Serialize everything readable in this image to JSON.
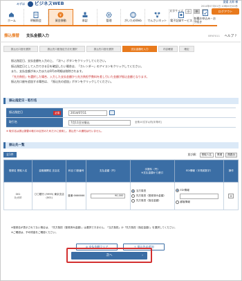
{
  "brand": {
    "sub": "みずほ",
    "name": "ビジネスWEB"
  },
  "user": {
    "name": "愛媛 太郎 様",
    "last_login": "2014年07月01日 10時00分00秒"
  },
  "util": {
    "size_label": "文字サイズ",
    "sizes": [
      "小",
      "中",
      "大"
    ],
    "logout": "ログアウト"
  },
  "nav": [
    {
      "label": "ホーム",
      "icon": "home-icon"
    },
    {
      "label": "明細照会",
      "icon": "document-icon"
    },
    {
      "label": "資金移動",
      "icon": "yen-icon",
      "active": true
    },
    {
      "label": "承認",
      "icon": "stamp-icon"
    },
    {
      "label": "管理",
      "icon": "gear-icon"
    },
    {
      "label": "がいためWeb",
      "icon": "globe-icon"
    },
    {
      "label": "でんさいネット",
      "icon": "network-icon"
    },
    {
      "label": "電子記録サービス",
      "icon": "record-icon"
    },
    {
      "label": "各種お申込み・お手続き",
      "icon": "form-icon"
    }
  ],
  "title": {
    "category": "振込振替",
    "main": "支払金額入力",
    "screen_id": "BFKF011",
    "help": "ヘルプ"
  },
  "steps": [
    "振込元口座を選択",
    "振込先口座指定方法を選択",
    "振込先口座を選択",
    "支払金額を入力",
    "内容確認",
    "確定"
  ],
  "note": {
    "l1": "振込指定日、支払金額を入力の上、「次へ」ボタンをクリックしてください。",
    "l2": "振込指定日として入力できる日を確認したい場合は、「カレンダー」のアイコンをクリックしてください。",
    "l3": "また、支払金額が未入力または0円の明細は削除されます。",
    "l4": "「先方負担」を選択した場合、入力した支払金額から先方負担手数料を差し引いた金額が振込金額となります。",
    "l5": "振込先口座を追加する場合は、「振込先の追加」ボタンをクリックしてください。"
  },
  "section1": {
    "title": "振込指定日・取引名"
  },
  "form": {
    "date_label": "振込指定日",
    "required": "必須",
    "date_value": "2014/07/11",
    "name_label": "取引名",
    "name_value": "7月11日分振込",
    "name_hint": "全角10文字以内[半角可]",
    "caution": "※ 取引名は振込振替の取引の区別のためだけに使用し、振込先への通知は行いません。"
  },
  "section2": {
    "title": "振込先一覧"
  },
  "list": {
    "count": "全1件",
    "sort_label": "並び順：",
    "sort_value": "受取人名",
    "order_value": "昇順",
    "sort_button": "再表示"
  },
  "table": {
    "headers": [
      "登録名 受取人名",
      "金融機関名 支店名",
      "科目 口座番号",
      "支払金額（円）",
      "手数料（円）",
      "EDI情報（半角英数字）",
      "操作"
    ],
    "fee_head_sub": "※支払金額から差引",
    "rows": [
      {
        "reg": "001",
        "payee": "ｴﾋﾒﾀﾛｳ",
        "bank": "〇〇銀行 (9999) 東京支店 (001)",
        "account": "普通 6666666",
        "amount": "90,000",
        "fee_opts": [
          "当方負担",
          "先方負担（登録済み金額）",
          "先方負担（指定金額）"
        ],
        "fee_sel": 0,
        "edi_opts": [
          "EDI情報",
          "顧客情報"
        ],
        "edi_sel": 0,
        "delete": "×"
      }
    ]
  },
  "foot": {
    "l1": "※登録名が表示されてない場合は、「先方負担（登録済み金額）」は選択できません。「当方負担」か「先方負担（指定金額）」を選択してください。",
    "l2": "※ご確認は、予め残高をご確認ください。"
  },
  "buttons": {
    "clear": "支払金額クリア",
    "add": "振込先の追加",
    "next": "次へ"
  }
}
